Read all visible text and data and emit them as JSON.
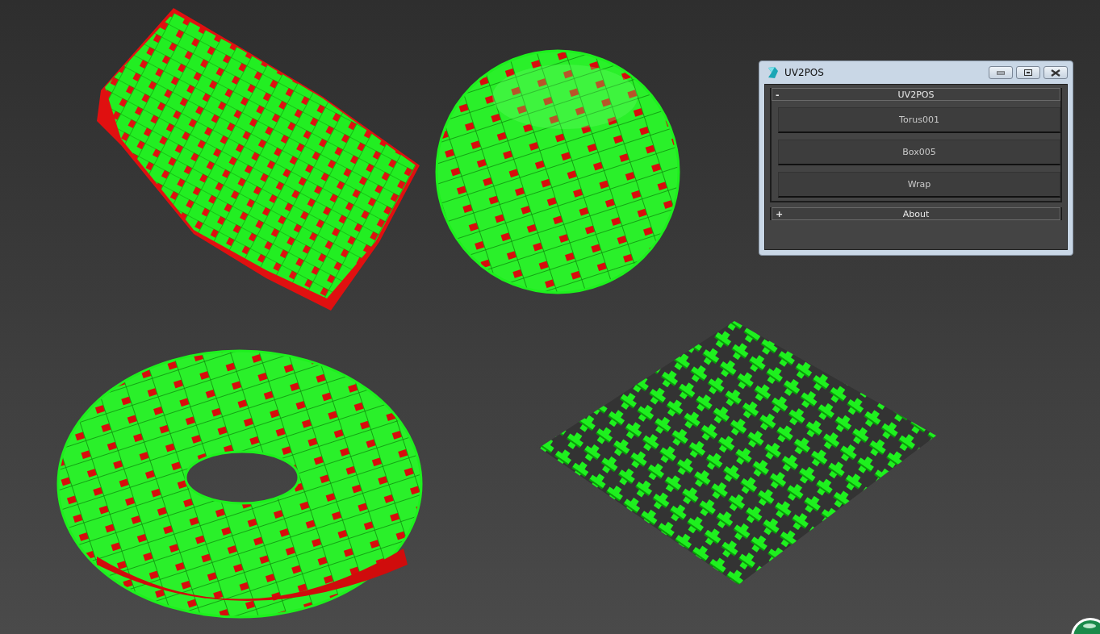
{
  "window": {
    "title": "UV2POS"
  },
  "rollouts": [
    {
      "toggle": "-",
      "title": "UV2POS",
      "buttons": [
        "Torus001",
        "Box005",
        "Wrap"
      ]
    },
    {
      "toggle": "+",
      "title": "About"
    }
  ]
}
